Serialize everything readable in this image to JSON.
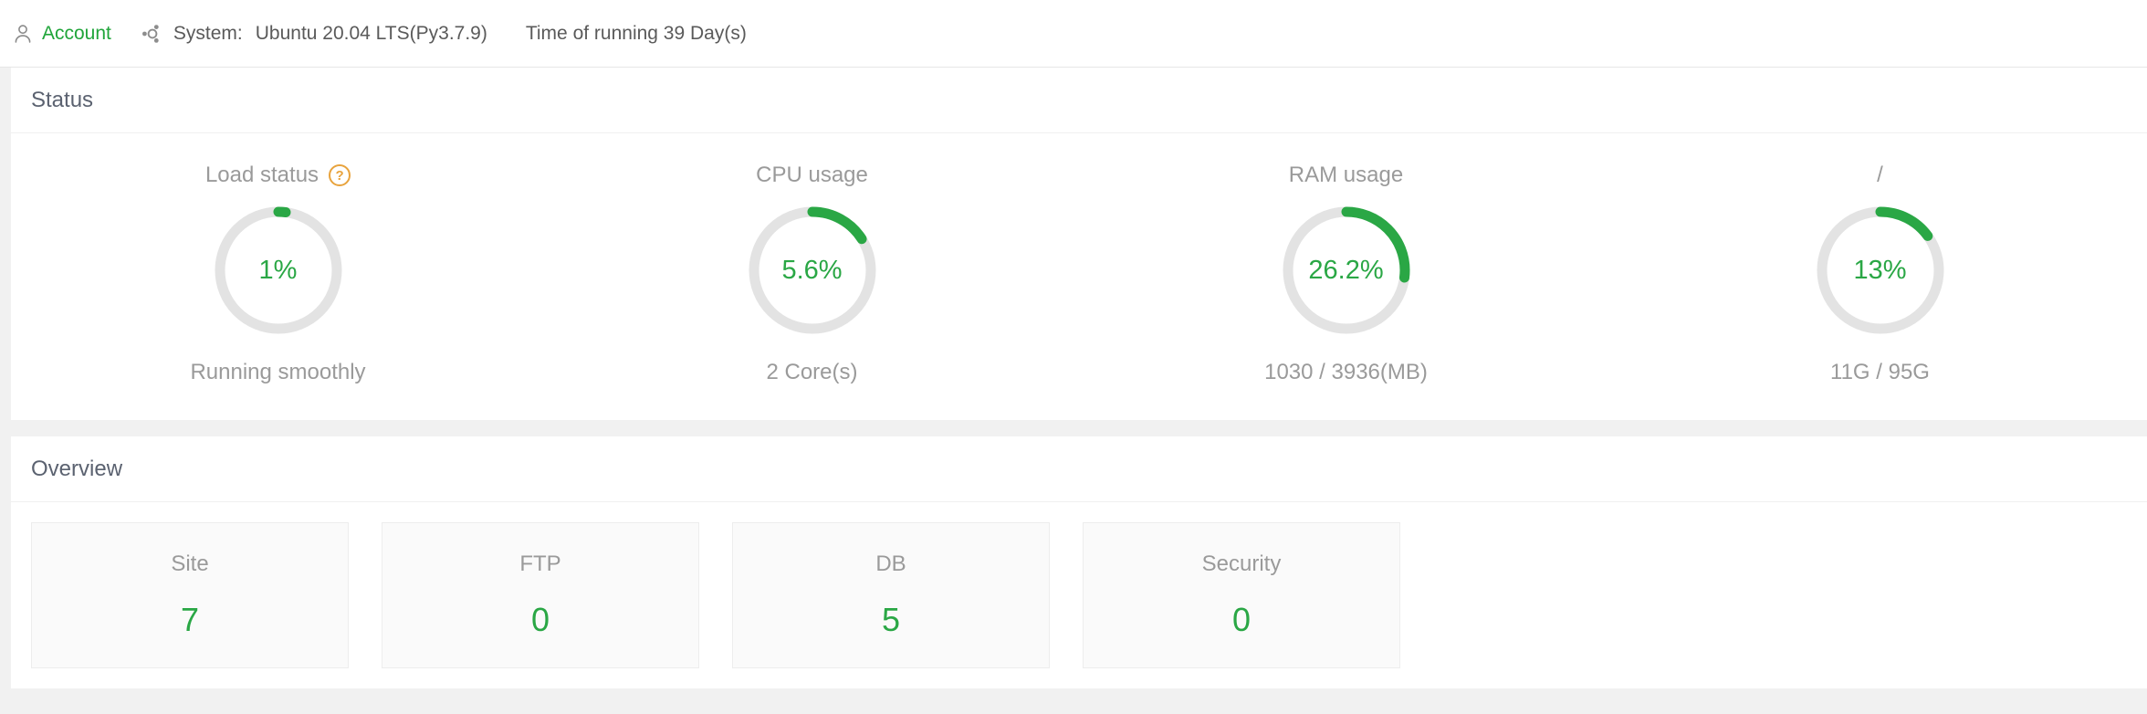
{
  "header": {
    "account_icon": "user-icon",
    "account_label": "Account",
    "os_icon": "ubuntu-icon",
    "system_label": "System:",
    "system_value": "Ubuntu 20.04 LTS(Py3.7.9)",
    "uptime": "Time of running 39 Day(s)",
    "accent_color": "#20a53a"
  },
  "status_panel": {
    "title": "Status",
    "gauges": [
      {
        "label": "Load status",
        "help_icon": "question-mark-icon",
        "value": "1%",
        "percent": 1,
        "arc_percent": 2,
        "sub": "Running smoothly",
        "color": "#2aa745"
      },
      {
        "label": "CPU usage",
        "help_icon": null,
        "value": "5.6%",
        "percent": 5.6,
        "arc_percent": 16,
        "sub": "2 Core(s)",
        "color": "#2aa745"
      },
      {
        "label": "RAM usage",
        "help_icon": null,
        "value": "26.2%",
        "percent": 26.2,
        "arc_percent": 27,
        "sub": "1030 / 3936(MB)",
        "color": "#2aa745"
      },
      {
        "label": "/",
        "help_icon": null,
        "value": "13%",
        "percent": 13,
        "arc_percent": 15,
        "sub": "11G / 95G",
        "color": "#2aa745"
      }
    ]
  },
  "overview_panel": {
    "title": "Overview",
    "cards": [
      {
        "label": "Site",
        "value": "7"
      },
      {
        "label": "FTP",
        "value": "0"
      },
      {
        "label": "DB",
        "value": "5"
      },
      {
        "label": "Security",
        "value": "0"
      }
    ]
  }
}
